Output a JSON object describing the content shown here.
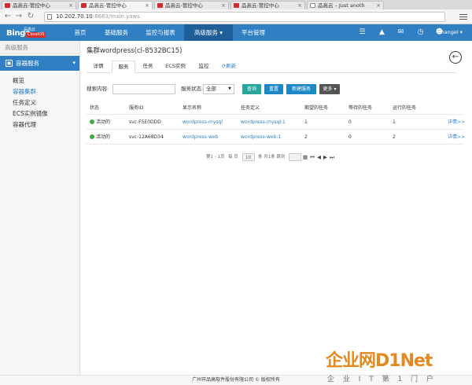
{
  "browser": {
    "tabs": [
      {
        "title": "品高云-管控中心",
        "icon": "favicon",
        "active": false
      },
      {
        "title": "品高云-管控中心",
        "icon": "favicon",
        "active": true
      },
      {
        "title": "品高云-管控中心",
        "icon": "favicon",
        "active": false
      },
      {
        "title": "品高云-管控中心",
        "icon": "favicon",
        "active": false
      },
      {
        "title": "品高云 – Just anoth",
        "icon": "document",
        "active": false
      }
    ],
    "url_host": "10.202.70.10",
    "url_rest": ":8663/main.yaws"
  },
  "app": {
    "logo_text": "Bingo",
    "logo_sub": "品高云",
    "logo_badge": "CloudOS",
    "nav": [
      "首页",
      "基础服务",
      "监控与报表",
      "高级服务 ▾",
      "平台管理"
    ],
    "active_nav": "高级服务",
    "header_icons": [
      "list-icon",
      "alert-icon",
      "mail-icon",
      "clock-icon",
      "user-icon"
    ],
    "user": "zhangel ▾",
    "brand_color": "#2f7fc2"
  },
  "sidebar": {
    "title": "高级服务",
    "group": "容器服务",
    "items": [
      "概览",
      "容器集群",
      "任务定义",
      "ECS实例镜像",
      "容器代理"
    ],
    "active_item": "容器集群"
  },
  "page": {
    "title": "集群wordpress(cl-8532BC15)",
    "tabs": [
      "详情",
      "服务",
      "任务",
      "ECS实例",
      "监控",
      "刷新"
    ],
    "active_tab": "服务",
    "filter": {
      "search_label": "搜索内容:",
      "search_value": "",
      "status_label": "服务状态:",
      "status_value": "全部",
      "buttons": {
        "query": "查询",
        "reset": "重置",
        "create": "新建服务",
        "more": "更多 ▾"
      }
    },
    "table": {
      "columns": [
        "状态",
        "服务ID",
        "显示名称",
        "任务定义",
        "期望的任务",
        "等待的任务",
        "运行的任务",
        ""
      ],
      "rows": [
        {
          "status": "活动的",
          "id": "svc-F5E0DDD",
          "name": "wordpress-mysql",
          "task_def": "wordpress-mysql:1",
          "desired": "1",
          "pending": "0",
          "running": "1",
          "detail": "详情>>"
        },
        {
          "status": "活动的",
          "id": "svc-12A68D34",
          "name": "wordpress-web",
          "task_def": "wordpress-web:1",
          "desired": "2",
          "pending": "0",
          "running": "2",
          "detail": "详情>>"
        }
      ]
    },
    "pager": {
      "range": "第1 - 1页",
      "per_page": "每 页",
      "per_page_value": "10",
      "count_text": "条 共1条 跳到",
      "jump_value": ""
    }
  },
  "footer": {
    "copyright": "广州市品高软件股份有限公司 © 版权所有"
  },
  "watermark": {
    "main": "企业网D1Net",
    "sub": "企 业 I T 第 1 门 户"
  },
  "colors": {
    "primary": "#2f7fc2",
    "success": "#3fa944",
    "teal": "#26a69a",
    "info": "#1e88c7",
    "dark": "#555555",
    "badge": "#d8302a",
    "watermark": "#e38920"
  }
}
